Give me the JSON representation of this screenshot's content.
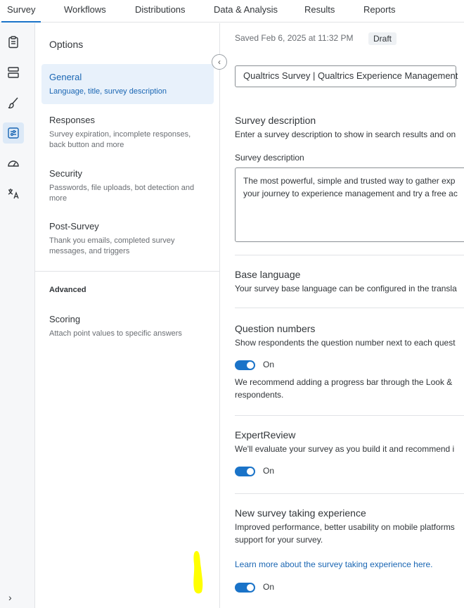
{
  "topnav": {
    "tabs": [
      {
        "label": "Survey"
      },
      {
        "label": "Workflows"
      },
      {
        "label": "Distributions"
      },
      {
        "label": "Data & Analysis"
      },
      {
        "label": "Results"
      },
      {
        "label": "Reports"
      }
    ]
  },
  "rail": {
    "icons": [
      "clipboard-icon",
      "blocks-icon",
      "brush-icon",
      "survey-options-icon",
      "gauge-icon",
      "translate-icon"
    ],
    "expand_glyph": "›"
  },
  "options": {
    "heading": "Options",
    "items": [
      {
        "title": "General",
        "desc": "Language, title, survey description"
      },
      {
        "title": "Responses",
        "desc": "Survey expiration, incomplete responses, back button and more"
      },
      {
        "title": "Security",
        "desc": "Passwords, file uploads, bot detection and more"
      },
      {
        "title": "Post-Survey",
        "desc": "Thank you emails, completed survey messages, and triggers"
      }
    ],
    "advanced_heading": "Advanced",
    "advanced_items": [
      {
        "title": "Scoring",
        "desc": "Attach point values to specific answers"
      }
    ],
    "collapse_glyph": "‹"
  },
  "main": {
    "saved": "Saved Feb 6, 2025 at 11:32 PM",
    "status": "Draft",
    "survey_title_value": "Qualtrics Survey | Qualtrics Experience Management",
    "description": {
      "heading": "Survey description",
      "text": "Enter a survey description to show in search results and on",
      "field_label": "Survey description",
      "value_line1": "The most powerful, simple and trusted way to gather exp",
      "value_line2": "your journey to experience management and try a free ac"
    },
    "base_language": {
      "heading": "Base language",
      "text": "Your survey base language can be configured in the transla"
    },
    "question_numbers": {
      "heading": "Question numbers",
      "text": "Show respondents the question number next to each quest",
      "toggle_label": "On",
      "note_line1": "We recommend adding a progress bar through the Look &",
      "note_line2": "respondents."
    },
    "expert_review": {
      "heading": "ExpertReview",
      "text": "We'll evaluate your survey as you build it and recommend i",
      "toggle_label": "On"
    },
    "new_experience": {
      "heading": "New survey taking experience",
      "text_line1": "Improved performance, better usability on mobile platforms",
      "text_line2": "support for your survey.",
      "link": "Learn more about the survey taking experience here.",
      "toggle_label": "On"
    }
  },
  "colors": {
    "accent": "#1a73c8",
    "active_bg": "#e8f1fb",
    "highlight": "#ffff00"
  }
}
